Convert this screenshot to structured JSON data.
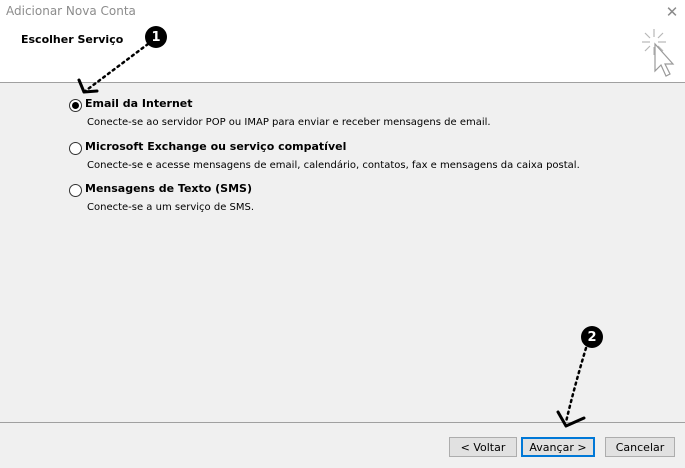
{
  "window": {
    "title": "Adicionar Nova Conta",
    "close_glyph": "✕"
  },
  "header": {
    "section_title": "Escolher Serviço",
    "decor_icon": "cursor-sparkle-icon"
  },
  "options": [
    {
      "label": "Email da Internet",
      "description": "Conecte-se ao servidor POP ou IMAP para enviar e receber mensagens de email.",
      "selected": true
    },
    {
      "label": "Microsoft Exchange ou serviço compatível",
      "description": "Conecte-se e acesse mensagens de email, calendário, contatos, fax e mensagens da caixa postal.",
      "selected": false
    },
    {
      "label": "Mensagens de Texto (SMS)",
      "description": "Conecte-se a um serviço de SMS.",
      "selected": false
    }
  ],
  "buttons": {
    "back": "< Voltar",
    "next": "Avançar >",
    "cancel": "Cancelar"
  },
  "annotations": {
    "step1": "1",
    "step2": "2"
  },
  "colors": {
    "default_button_border": "#0078d7"
  }
}
